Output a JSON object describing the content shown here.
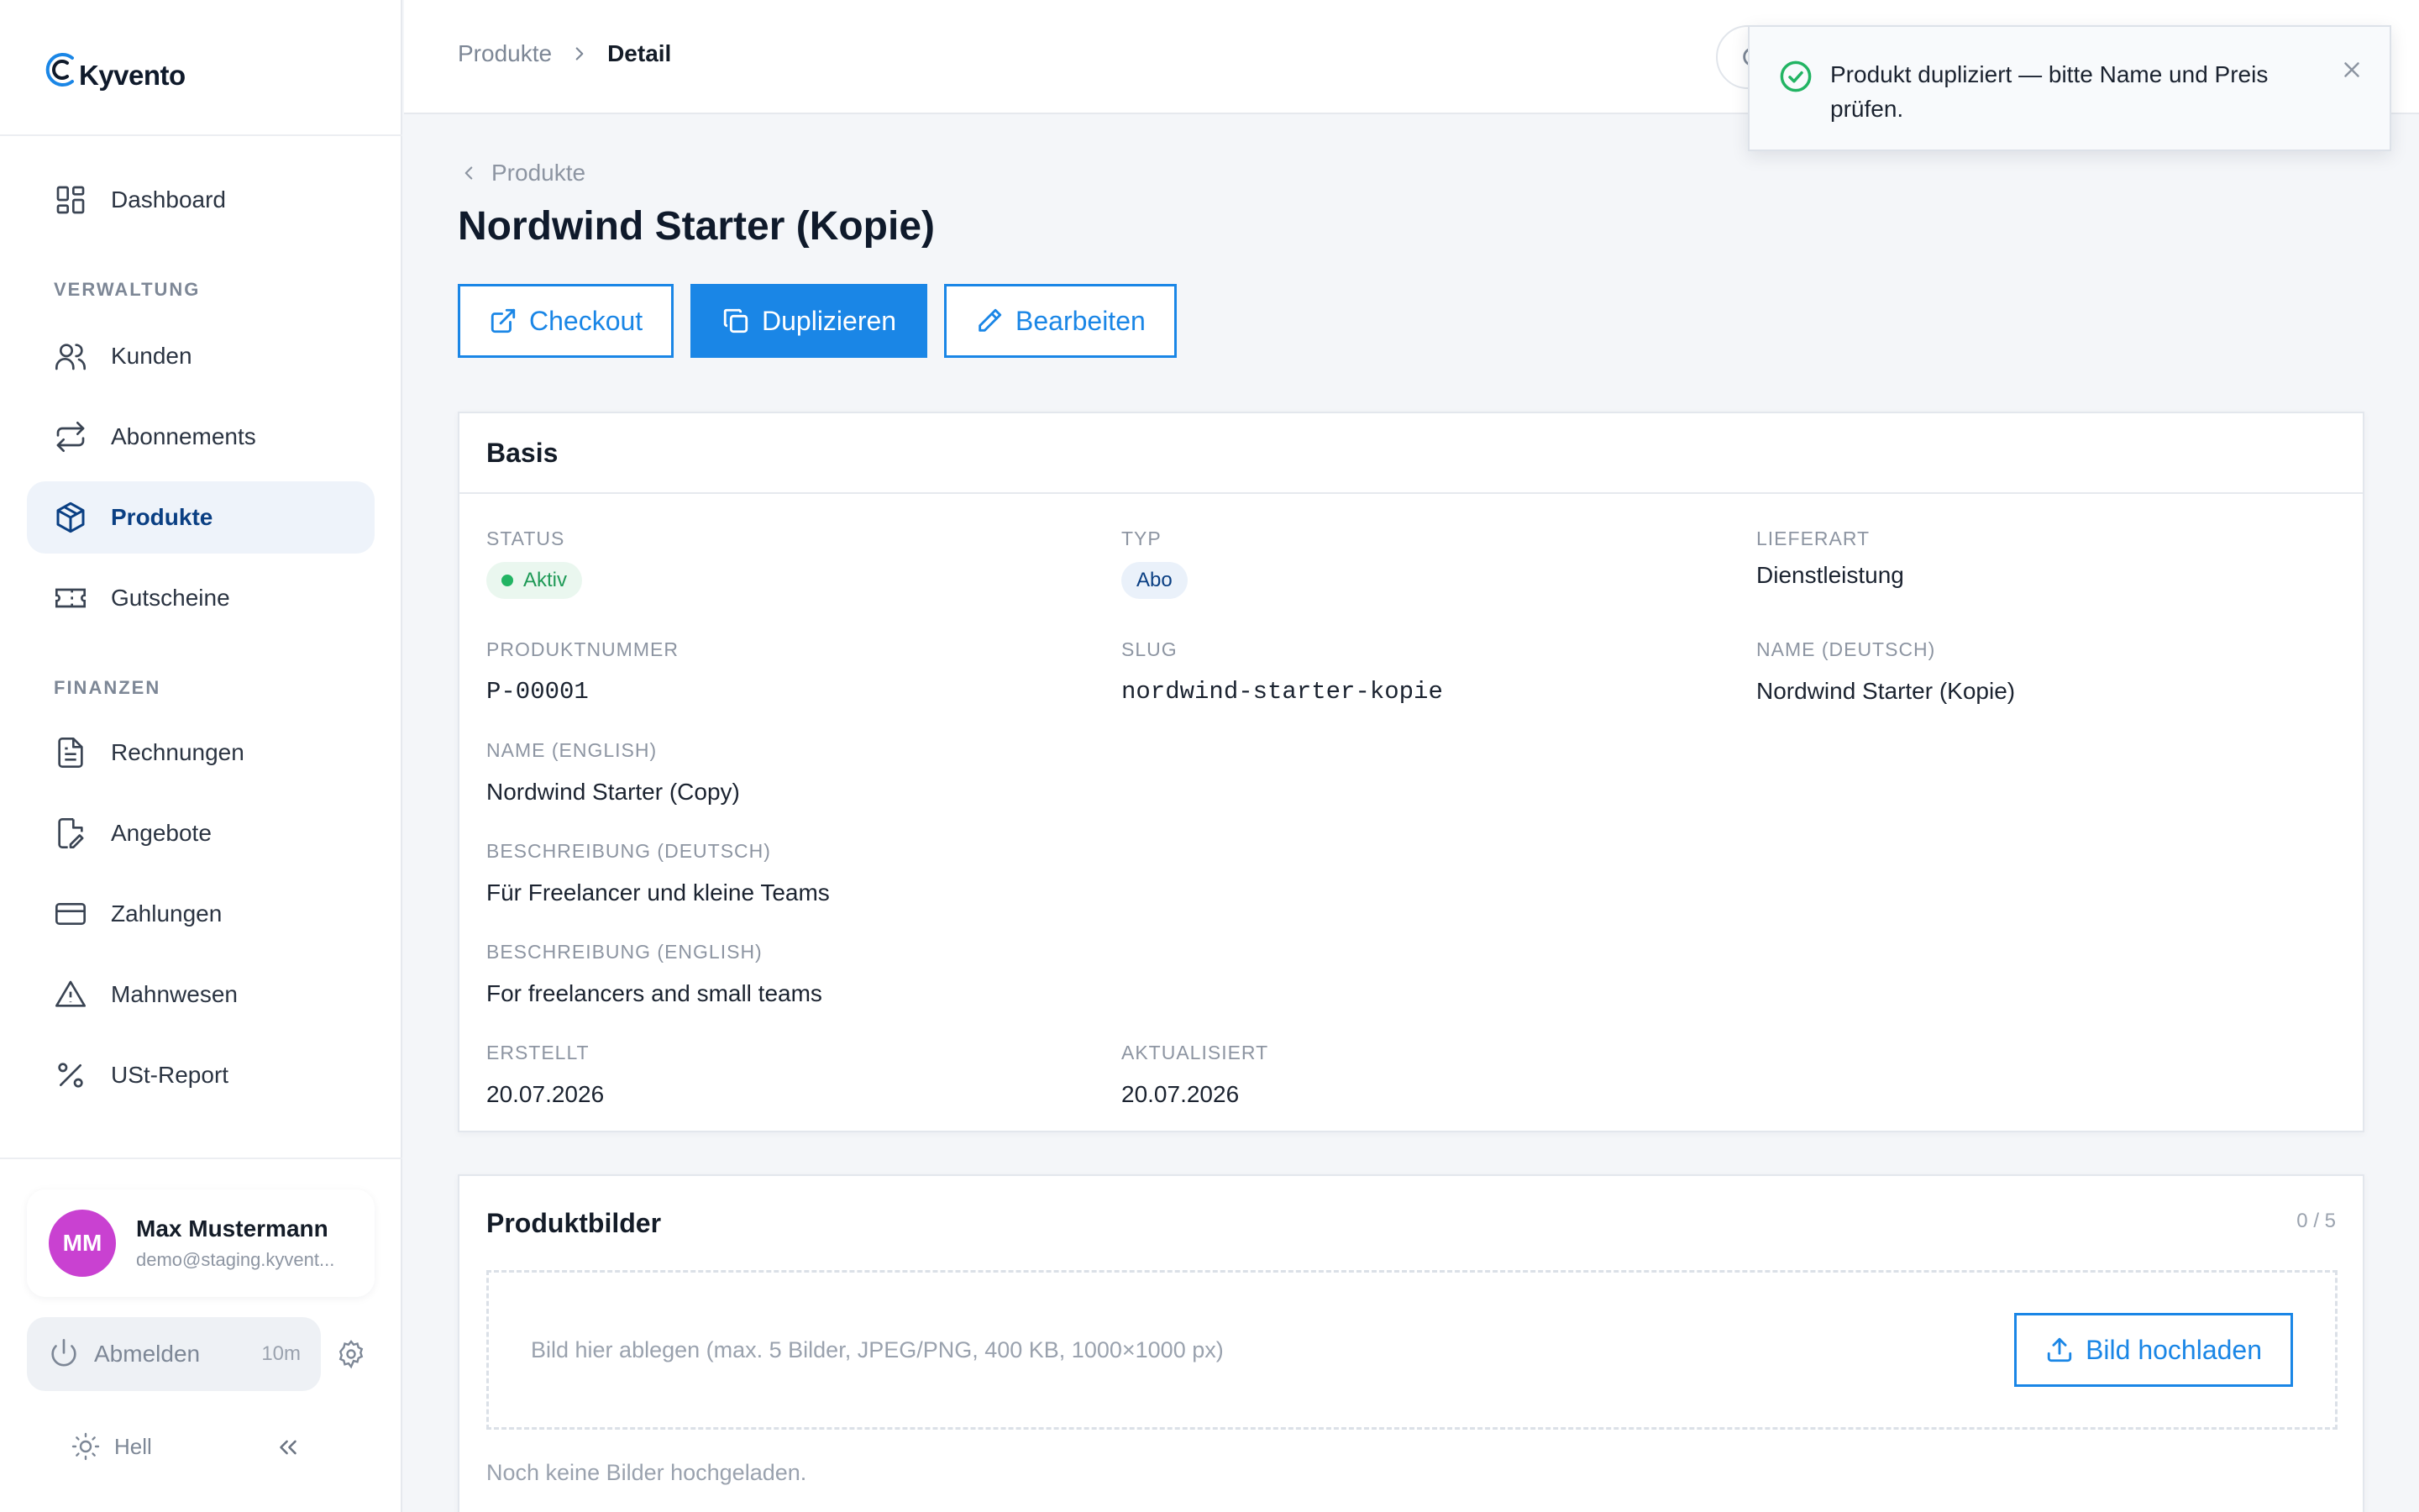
{
  "app": {
    "name": "Kyvento"
  },
  "sidebar": {
    "items": [
      {
        "label": "Dashboard",
        "icon": "dashboard-icon"
      },
      {
        "label": "Kunden",
        "icon": "users-icon"
      },
      {
        "label": "Abonnements",
        "icon": "repeat-icon"
      },
      {
        "label": "Produkte",
        "icon": "box-icon",
        "active": true
      },
      {
        "label": "Gutscheine",
        "icon": "ticket-icon"
      },
      {
        "label": "Rechnungen",
        "icon": "file-icon"
      },
      {
        "label": "Angebote",
        "icon": "file-edit-icon"
      },
      {
        "label": "Zahlungen",
        "icon": "credit-card-icon"
      },
      {
        "label": "Mahnwesen",
        "icon": "alert-triangle-icon"
      },
      {
        "label": "USt-Report",
        "icon": "percent-icon"
      }
    ],
    "sections": {
      "verwaltung": "VERWALTUNG",
      "finanzen": "FINANZEN"
    },
    "user": {
      "initials": "MM",
      "name": "Max Mustermann",
      "email": "demo@staging.kyvent...",
      "avatar_color": "#c941d1"
    },
    "logout": {
      "label": "Abmelden",
      "time": "10m"
    },
    "theme": {
      "label": "Hell"
    }
  },
  "topbar": {
    "breadcrumb": {
      "parent": "Produkte",
      "current": "Detail"
    }
  },
  "toast": {
    "message": "Produkt dupliziert — bitte Name und Preis prüfen."
  },
  "main": {
    "back_label": "Produkte",
    "title": "Nordwind Starter (Kopie)",
    "actions": {
      "checkout": "Checkout",
      "duplicate": "Duplizieren",
      "edit": "Bearbeiten"
    },
    "basis": {
      "heading": "Basis",
      "status": {
        "label": "STATUS",
        "value": "Aktiv"
      },
      "typ": {
        "label": "TYP",
        "value": "Abo"
      },
      "lieferart": {
        "label": "LIEFERART",
        "value": "Dienstleistung"
      },
      "produktnummer": {
        "label": "PRODUKTNUMMER",
        "value": "P-00001"
      },
      "slug": {
        "label": "SLUG",
        "value": "nordwind-starter-kopie"
      },
      "name_de": {
        "label": "NAME (DEUTSCH)",
        "value": "Nordwind Starter (Kopie)"
      },
      "name_en": {
        "label": "NAME (ENGLISH)",
        "value": "Nordwind Starter (Copy)"
      },
      "desc_de": {
        "label": "BESCHREIBUNG (DEUTSCH)",
        "value": "Für Freelancer und kleine Teams"
      },
      "desc_en": {
        "label": "BESCHREIBUNG (ENGLISH)",
        "value": "For freelancers and small teams"
      },
      "erstellt": {
        "label": "ERSTELLT",
        "value": "20.07.2026"
      },
      "aktualisiert": {
        "label": "AKTUALISIERT",
        "value": "20.07.2026"
      }
    },
    "images": {
      "heading": "Produktbilder",
      "count": "0 / 5",
      "dropzone": "Bild hier ablegen (max. 5 Bilder, JPEG/PNG, 400 KB, 1000×1000 px)",
      "upload": "Bild hochladen",
      "empty": "Noch keine Bilder hochgeladen."
    }
  },
  "colors": {
    "accent": "#1a86e6",
    "active_nav": "#0a3f83",
    "success": "#22b463"
  }
}
